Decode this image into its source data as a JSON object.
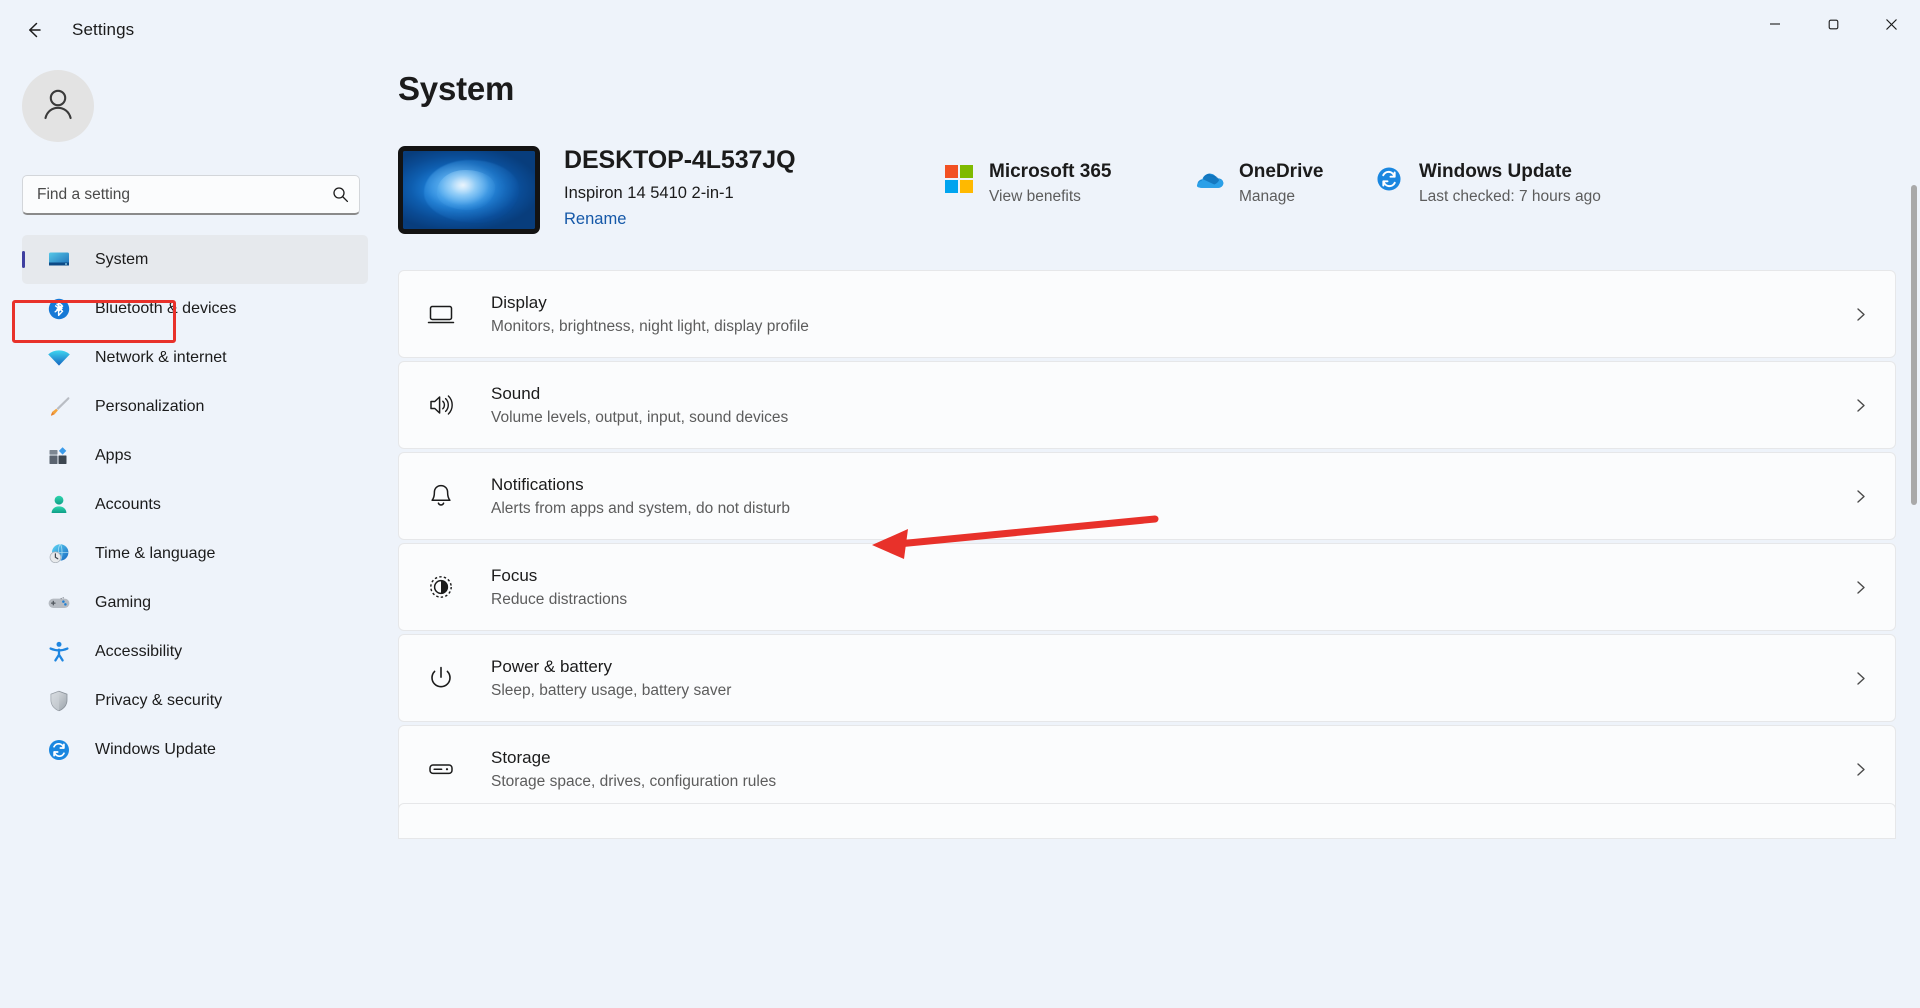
{
  "window": {
    "title": "Settings",
    "back_icon": "back-arrow-icon",
    "minimize_label": "—",
    "maximize_label": "❐",
    "close_label": "✕"
  },
  "sidebar": {
    "avatar_icon": "user-avatar-icon",
    "search": {
      "placeholder": "Find a setting",
      "value": "",
      "icon": "search-icon"
    },
    "items": [
      {
        "label": "System",
        "icon": "system-monitor-icon",
        "selected": true
      },
      {
        "label": "Bluetooth & devices",
        "icon": "bluetooth-icon",
        "selected": false
      },
      {
        "label": "Network & internet",
        "icon": "wifi-icon",
        "selected": false
      },
      {
        "label": "Personalization",
        "icon": "paintbrush-icon",
        "selected": false
      },
      {
        "label": "Apps",
        "icon": "apps-icon",
        "selected": false
      },
      {
        "label": "Accounts",
        "icon": "account-person-icon",
        "selected": false
      },
      {
        "label": "Time & language",
        "icon": "clock-globe-icon",
        "selected": false
      },
      {
        "label": "Gaming",
        "icon": "gamepad-icon",
        "selected": false
      },
      {
        "label": "Accessibility",
        "icon": "accessibility-person-icon",
        "selected": false
      },
      {
        "label": "Privacy & security",
        "icon": "shield-icon",
        "selected": false
      },
      {
        "label": "Windows Update",
        "icon": "update-refresh-icon",
        "selected": false
      }
    ]
  },
  "main": {
    "page_title": "System",
    "device": {
      "name": "DESKTOP-4L537JQ",
      "model": "Inspiron 14 5410 2-in-1",
      "rename_label": "Rename",
      "thumbnail_icon": "windows-wallpaper-thumbnail"
    },
    "services": [
      {
        "title": "Microsoft 365",
        "subtitle": "View benefits",
        "icon": "microsoft-logo-icon"
      },
      {
        "title": "OneDrive",
        "subtitle": "Manage",
        "icon": "onedrive-cloud-icon"
      },
      {
        "title": "Windows Update",
        "subtitle": "Last checked: 7 hours ago",
        "icon": "update-refresh-icon"
      }
    ],
    "settings": [
      {
        "title": "Display",
        "subtitle": "Monitors, brightness, night light, display profile",
        "icon": "display-monitor-icon"
      },
      {
        "title": "Sound",
        "subtitle": "Volume levels, output, input, sound devices",
        "icon": "speaker-icon"
      },
      {
        "title": "Notifications",
        "subtitle": "Alerts from apps and system, do not disturb",
        "icon": "bell-icon"
      },
      {
        "title": "Focus",
        "subtitle": "Reduce distractions",
        "icon": "focus-icon"
      },
      {
        "title": "Power & battery",
        "subtitle": "Sleep, battery usage, battery saver",
        "icon": "power-icon"
      },
      {
        "title": "Storage",
        "subtitle": "Storage space, drives, configuration rules",
        "icon": "storage-drive-icon"
      }
    ]
  },
  "annotations": {
    "highlight_color": "#e8312a",
    "arrow_color": "#e8312a",
    "highlight_target": "System",
    "arrow_target": "Notifications"
  }
}
